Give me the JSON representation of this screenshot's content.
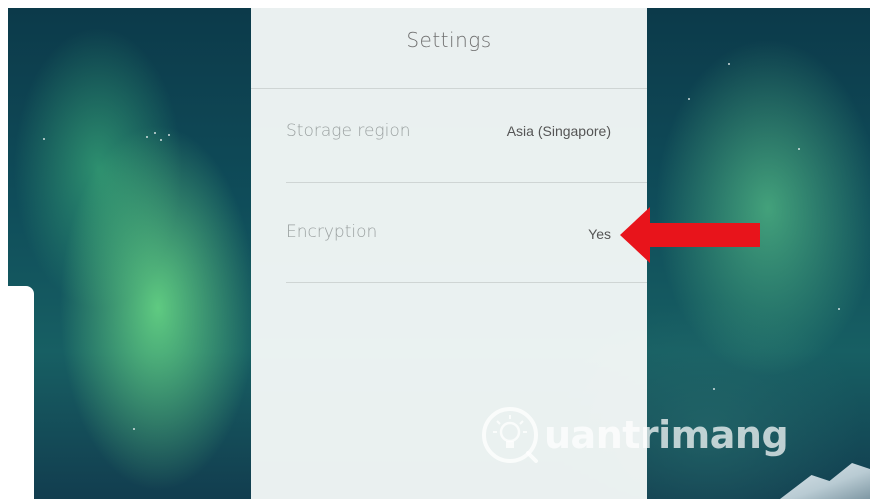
{
  "settings": {
    "title": "Settings",
    "rows": [
      {
        "label": "Storage region",
        "value": "Asia (Singapore)"
      },
      {
        "label": "Encryption",
        "value": "Yes"
      }
    ]
  },
  "watermark": {
    "text": "uantrimang"
  },
  "colors": {
    "arrow": "#e8141b",
    "panel": "#f4f8f7",
    "label": "#9aa0a0"
  },
  "icons": [
    "red-arrow-icon",
    "lightbulb-icon"
  ]
}
